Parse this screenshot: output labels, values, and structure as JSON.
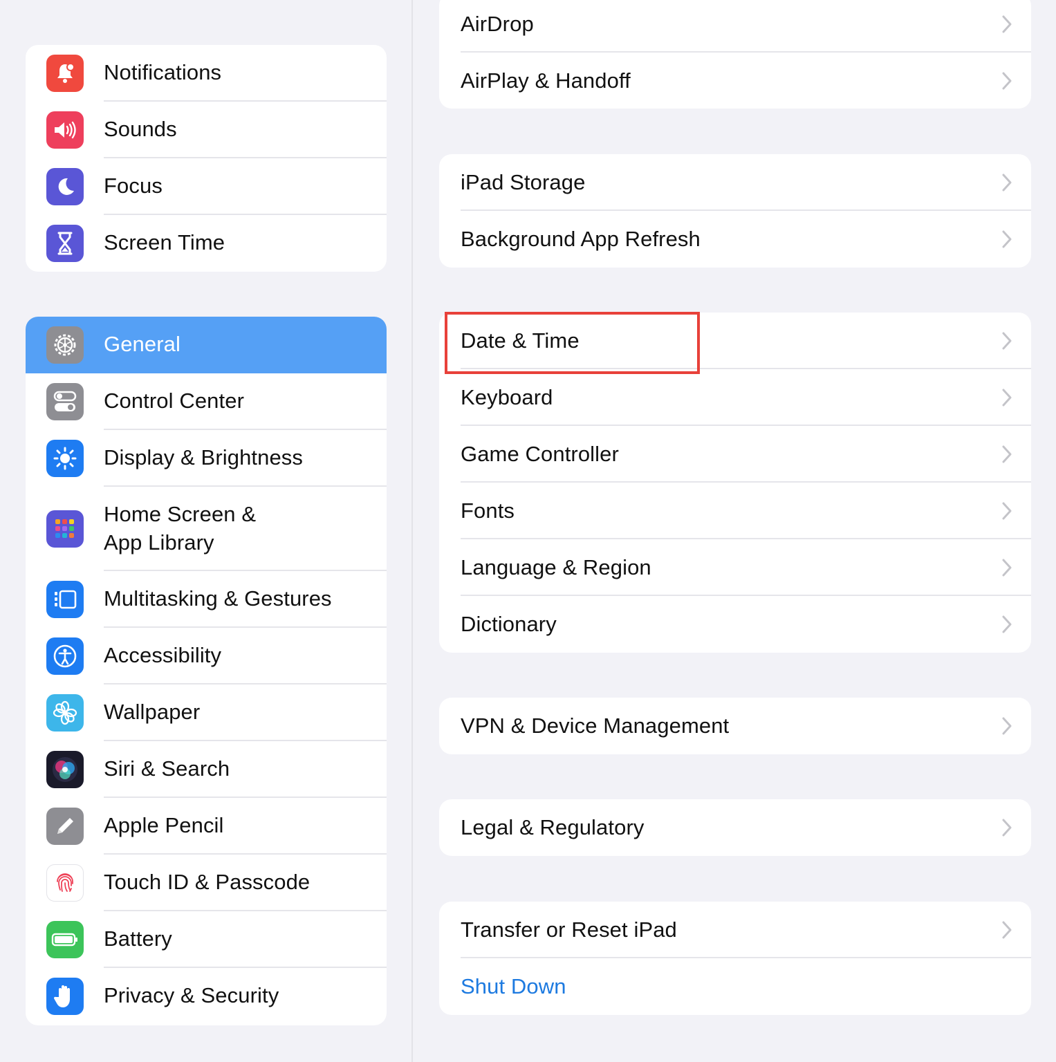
{
  "sidebar": {
    "group1": [
      {
        "label": "Notifications",
        "icon": "bell-icon",
        "color": "#f0493e"
      },
      {
        "label": "Sounds",
        "icon": "speaker-icon",
        "color": "#ee3f5c"
      },
      {
        "label": "Focus",
        "icon": "moon-icon",
        "color": "#5a56d6"
      },
      {
        "label": "Screen Time",
        "icon": "hourglass-icon",
        "color": "#5a56d6"
      }
    ],
    "group2": [
      {
        "label": "General",
        "icon": "gear-icon",
        "color": "#8e8e93",
        "selected": true
      },
      {
        "label": "Control Center",
        "icon": "toggles-icon",
        "color": "#8e8e93"
      },
      {
        "label": "Display & Brightness",
        "icon": "sun-icon",
        "color": "#1e7cf2"
      },
      {
        "label": "Home Screen &",
        "label2": "App Library",
        "icon": "app-grid-icon",
        "color": "#5a56d6"
      },
      {
        "label": "Multitasking & Gestures",
        "icon": "multitasking-icon",
        "color": "#1e7cf2"
      },
      {
        "label": "Accessibility",
        "icon": "accessibility-icon",
        "color": "#1e7cf2"
      },
      {
        "label": "Wallpaper",
        "icon": "flower-icon",
        "color": "#3db6ea"
      },
      {
        "label": "Siri & Search",
        "icon": "siri-icon",
        "color": "#222222"
      },
      {
        "label": "Apple Pencil",
        "icon": "pencil-icon",
        "color": "#8e8e93"
      },
      {
        "label": "Touch ID & Passcode",
        "icon": "fingerprint-icon",
        "color": "#ffffff"
      },
      {
        "label": "Battery",
        "icon": "battery-icon",
        "color": "#3cc45a"
      },
      {
        "label": "Privacy & Security",
        "icon": "hand-icon",
        "color": "#1e7cf2"
      }
    ]
  },
  "detail": {
    "group1": [
      {
        "label": "AirDrop"
      },
      {
        "label": "AirPlay & Handoff"
      }
    ],
    "group2": [
      {
        "label": "iPad Storage"
      },
      {
        "label": "Background App Refresh"
      }
    ],
    "group3": [
      {
        "label": "Date & Time",
        "highlighted": true
      },
      {
        "label": "Keyboard"
      },
      {
        "label": "Game Controller"
      },
      {
        "label": "Fonts"
      },
      {
        "label": "Language & Region"
      },
      {
        "label": "Dictionary"
      }
    ],
    "group4": [
      {
        "label": "VPN & Device Management"
      }
    ],
    "group5": [
      {
        "label": "Legal & Regulatory"
      }
    ],
    "group6": [
      {
        "label": "Transfer or Reset iPad"
      },
      {
        "label": "Shut Down",
        "link": true
      }
    ]
  },
  "colors": {
    "background": "#f2f2f7",
    "selected": "#55a0f5",
    "link": "#1d7ae0",
    "highlight": "#e8413a"
  }
}
